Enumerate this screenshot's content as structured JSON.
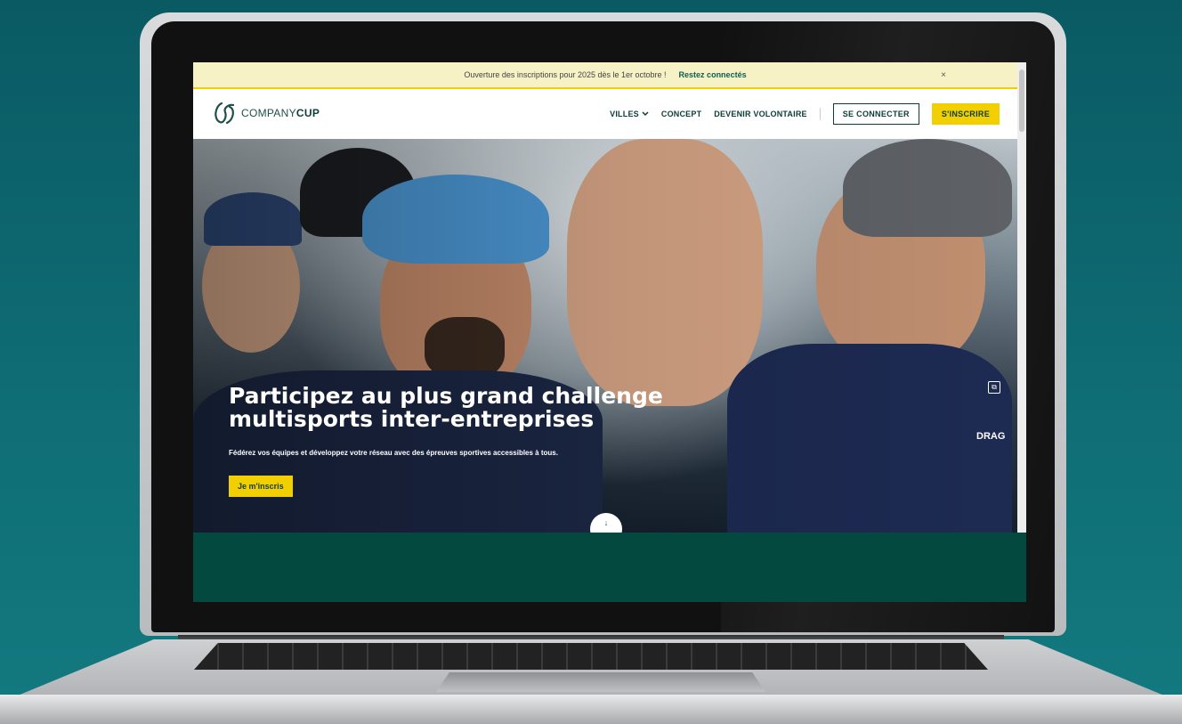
{
  "announcement": {
    "text": "Ouverture des inscriptions pour 2025 dès le 1er octobre !",
    "link": "Restez connectés",
    "close": "×"
  },
  "brand": {
    "name_light": "COMPANY",
    "name_bold": "CUP"
  },
  "nav": {
    "villes": "VILLES",
    "concept": "CONCEPT",
    "volontaire": "DEVENIR VOLONTAIRE",
    "login": "SE CONNECTER",
    "signup": "S'INSCRIRE"
  },
  "hero": {
    "title_line1": "Participez au plus grand challenge",
    "title_line2": "multisports inter-entreprises",
    "subtitle": "Fédérez vos équipes et développez votre réseau avec des épreuves sportives accessibles à tous.",
    "cta": "Je m'inscris",
    "shirt_text": "DRAG"
  },
  "colors": {
    "accent_yellow": "#f2cf00",
    "brand_green": "#0d3d37",
    "section_green": "#04493f",
    "announce_bg": "#f7f1c6"
  },
  "icons": {
    "chevron": "chevron-down-icon",
    "scroll": "arrow-down-icon",
    "pip": "picture-in-picture-icon",
    "close": "close-icon"
  }
}
